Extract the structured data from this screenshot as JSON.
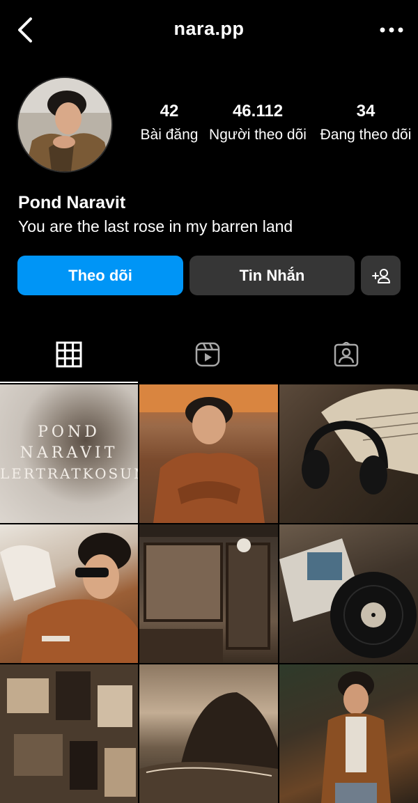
{
  "header": {
    "username": "nara.pp",
    "back_icon": "chevron-left-icon",
    "more_icon": "more-horizontal-icon"
  },
  "profile": {
    "display_name": "Pond Naravit",
    "bio": "You are the last rose in my barren land",
    "stats": [
      {
        "value": "42",
        "label": "Bài đăng"
      },
      {
        "value": "46.112",
        "label": "Người theo dõi"
      },
      {
        "value": "34",
        "label": "Đang theo dõi"
      }
    ]
  },
  "actions": {
    "follow_label": "Theo dõi",
    "message_label": "Tin Nhắn",
    "add_user_icon": "add-user-icon"
  },
  "tabs": [
    {
      "name": "posts",
      "icon": "grid-icon",
      "active": true
    },
    {
      "name": "reels",
      "icon": "reels-icon",
      "active": false
    },
    {
      "name": "tagged",
      "icon": "tagged-icon",
      "active": false
    }
  ],
  "posts": {
    "first_post_text": [
      "POND",
      "NARAVIT",
      "LERTRATKOSUM"
    ]
  },
  "colors": {
    "background": "#000000",
    "accent": "#0095f6",
    "secondary_button": "#363636",
    "text": "#ffffff"
  }
}
